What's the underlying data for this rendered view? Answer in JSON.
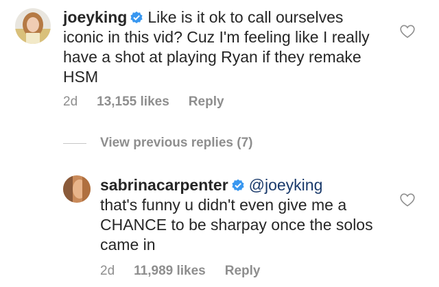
{
  "comments": [
    {
      "username": "joeyking",
      "verified": true,
      "mention": "",
      "text": "Like is it ok to call ourselves iconic in this vid? Cuz I'm feeling like I really have a shot at playing Ryan if they remake HSM",
      "time": "2d",
      "likes": "13,155 likes",
      "reply_label": "Reply"
    },
    {
      "username": "sabrinacarpenter",
      "verified": true,
      "mention": "@joeyking",
      "text": "that's funny u didn't even give me a CHANCE to be sharpay once the solos came in",
      "time": "2d",
      "likes": "11,989 likes",
      "reply_label": "Reply"
    }
  ],
  "view_previous_replies": "View previous replies (7)",
  "colors": {
    "text": "#262626",
    "meta": "#8e8e8e",
    "verified": "#3897f0",
    "mention": "#1a3a6b"
  },
  "icons": {
    "like": "heart-outline-icon",
    "verified": "verified-badge-icon"
  }
}
